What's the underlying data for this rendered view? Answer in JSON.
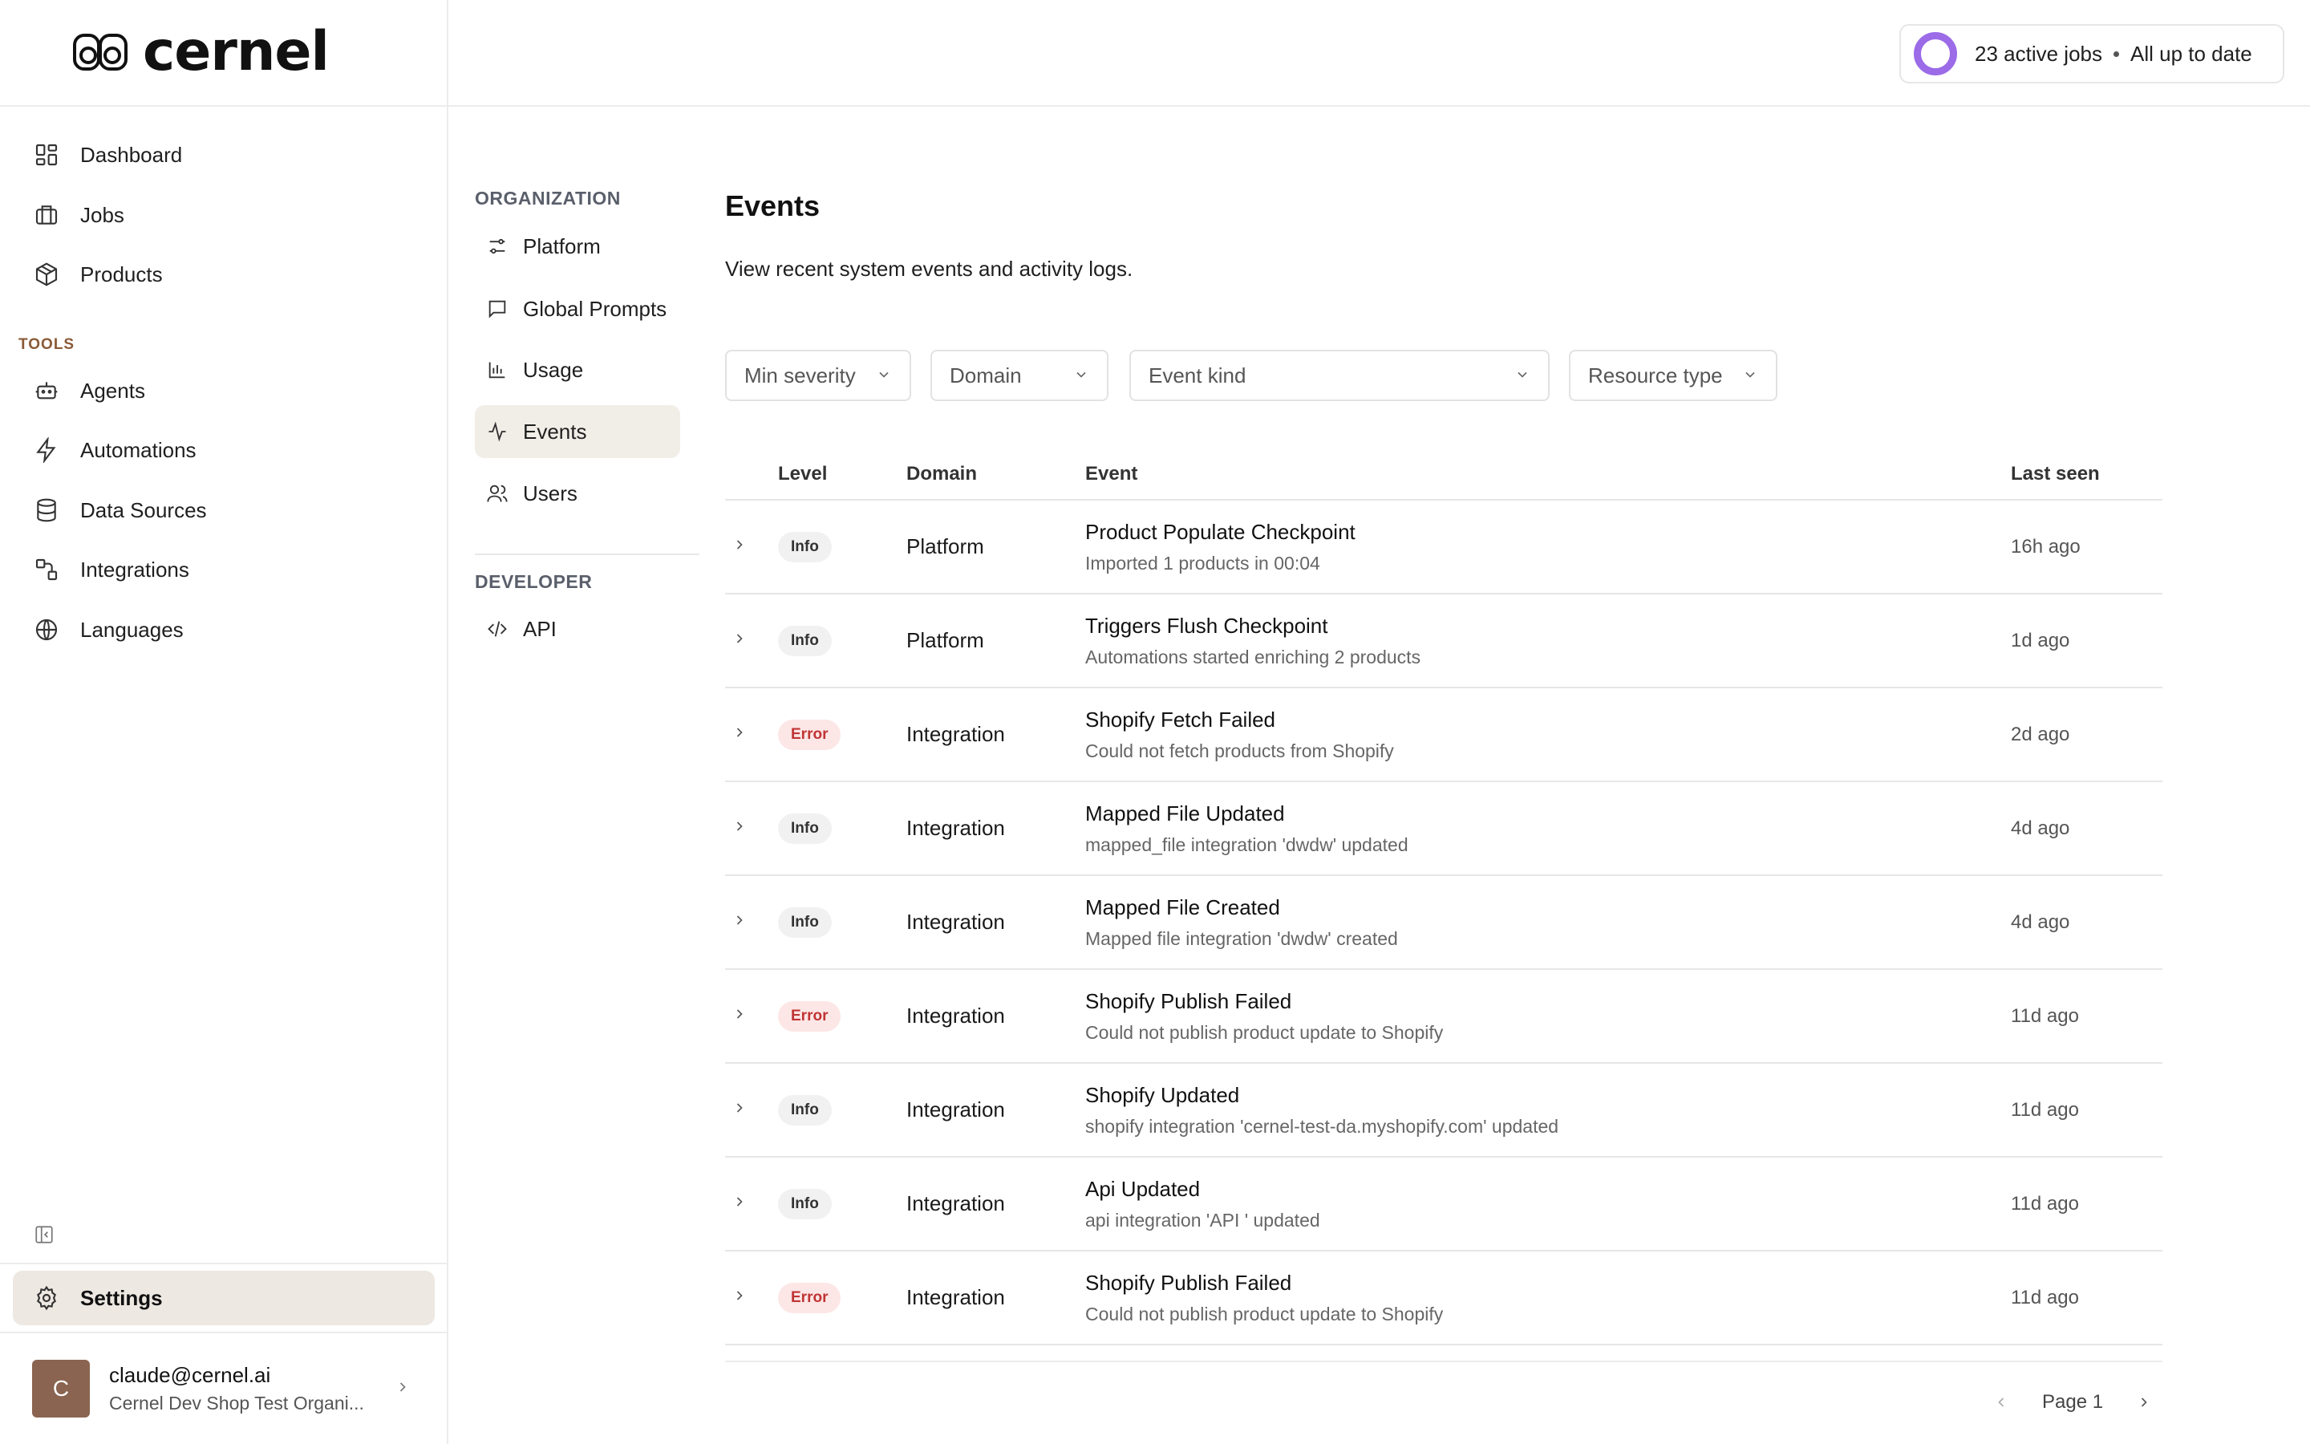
{
  "app": {
    "brand": "cernel"
  },
  "header": {
    "jobs_count": "23 active jobs",
    "jobs_status": "All up to date",
    "ring_color": "#9b6be8"
  },
  "sidebar": {
    "items": [
      {
        "label": "Dashboard",
        "icon": "dashboard-icon"
      },
      {
        "label": "Jobs",
        "icon": "briefcase-icon"
      },
      {
        "label": "Products",
        "icon": "box-icon"
      }
    ],
    "tools_label": "TOOLS",
    "tools": [
      {
        "label": "Agents",
        "icon": "bot-icon"
      },
      {
        "label": "Automations",
        "icon": "lightning-icon"
      },
      {
        "label": "Data Sources",
        "icon": "database-icon"
      },
      {
        "label": "Integrations",
        "icon": "integration-icon"
      },
      {
        "label": "Languages",
        "icon": "globe-icon"
      }
    ],
    "settings_label": "Settings",
    "user": {
      "avatar_initial": "C",
      "email": "claude@cernel.ai",
      "org": "Cernel Dev Shop Test Organi..."
    }
  },
  "subnav": {
    "organization_label": "ORGANIZATION",
    "organization_items": [
      {
        "label": "Platform",
        "icon": "sliders-icon"
      },
      {
        "label": "Global Prompts",
        "icon": "message-icon"
      },
      {
        "label": "Usage",
        "icon": "bar-chart-icon"
      },
      {
        "label": "Events",
        "icon": "activity-icon",
        "active": true
      },
      {
        "label": "Users",
        "icon": "users-icon"
      }
    ],
    "developer_label": "DEVELOPER",
    "developer_items": [
      {
        "label": "API",
        "icon": "code-icon"
      }
    ]
  },
  "main": {
    "title": "Events",
    "description": "View recent system events and activity logs.",
    "filters": {
      "min_severity": "Min severity",
      "domain": "Domain",
      "event_kind": "Event kind",
      "resource_type": "Resource type"
    },
    "columns": {
      "level": "Level",
      "domain": "Domain",
      "event": "Event",
      "last_seen": "Last seen"
    },
    "rows": [
      {
        "level": "Info",
        "level_type": "info",
        "domain": "Platform",
        "title": "Product Populate Checkpoint",
        "subtitle": "Imported 1 products in 00:04",
        "last_seen": "16h ago"
      },
      {
        "level": "Info",
        "level_type": "info",
        "domain": "Platform",
        "title": "Triggers Flush Checkpoint",
        "subtitle": "Automations started enriching 2 products",
        "last_seen": "1d ago"
      },
      {
        "level": "Error",
        "level_type": "error",
        "domain": "Integration",
        "title": "Shopify Fetch Failed",
        "subtitle": "Could not fetch products from Shopify",
        "last_seen": "2d ago"
      },
      {
        "level": "Info",
        "level_type": "info",
        "domain": "Integration",
        "title": "Mapped File Updated",
        "subtitle": "mapped_file integration 'dwdw' updated",
        "last_seen": "4d ago"
      },
      {
        "level": "Info",
        "level_type": "info",
        "domain": "Integration",
        "title": "Mapped File Created",
        "subtitle": "Mapped file integration 'dwdw' created",
        "last_seen": "4d ago"
      },
      {
        "level": "Error",
        "level_type": "error",
        "domain": "Integration",
        "title": "Shopify Publish Failed",
        "subtitle": "Could not publish product update to Shopify",
        "last_seen": "11d ago"
      },
      {
        "level": "Info",
        "level_type": "info",
        "domain": "Integration",
        "title": "Shopify Updated",
        "subtitle": "shopify integration 'cernel-test-da.myshopify.com' updated",
        "last_seen": "11d ago"
      },
      {
        "level": "Info",
        "level_type": "info",
        "domain": "Integration",
        "title": "Api Updated",
        "subtitle": "api integration 'API ' updated",
        "last_seen": "11d ago"
      },
      {
        "level": "Error",
        "level_type": "error",
        "domain": "Integration",
        "title": "Shopify Publish Failed",
        "subtitle": "Could not publish product update to Shopify",
        "last_seen": "11d ago"
      }
    ],
    "pagination": {
      "page_label": "Page 1"
    }
  }
}
